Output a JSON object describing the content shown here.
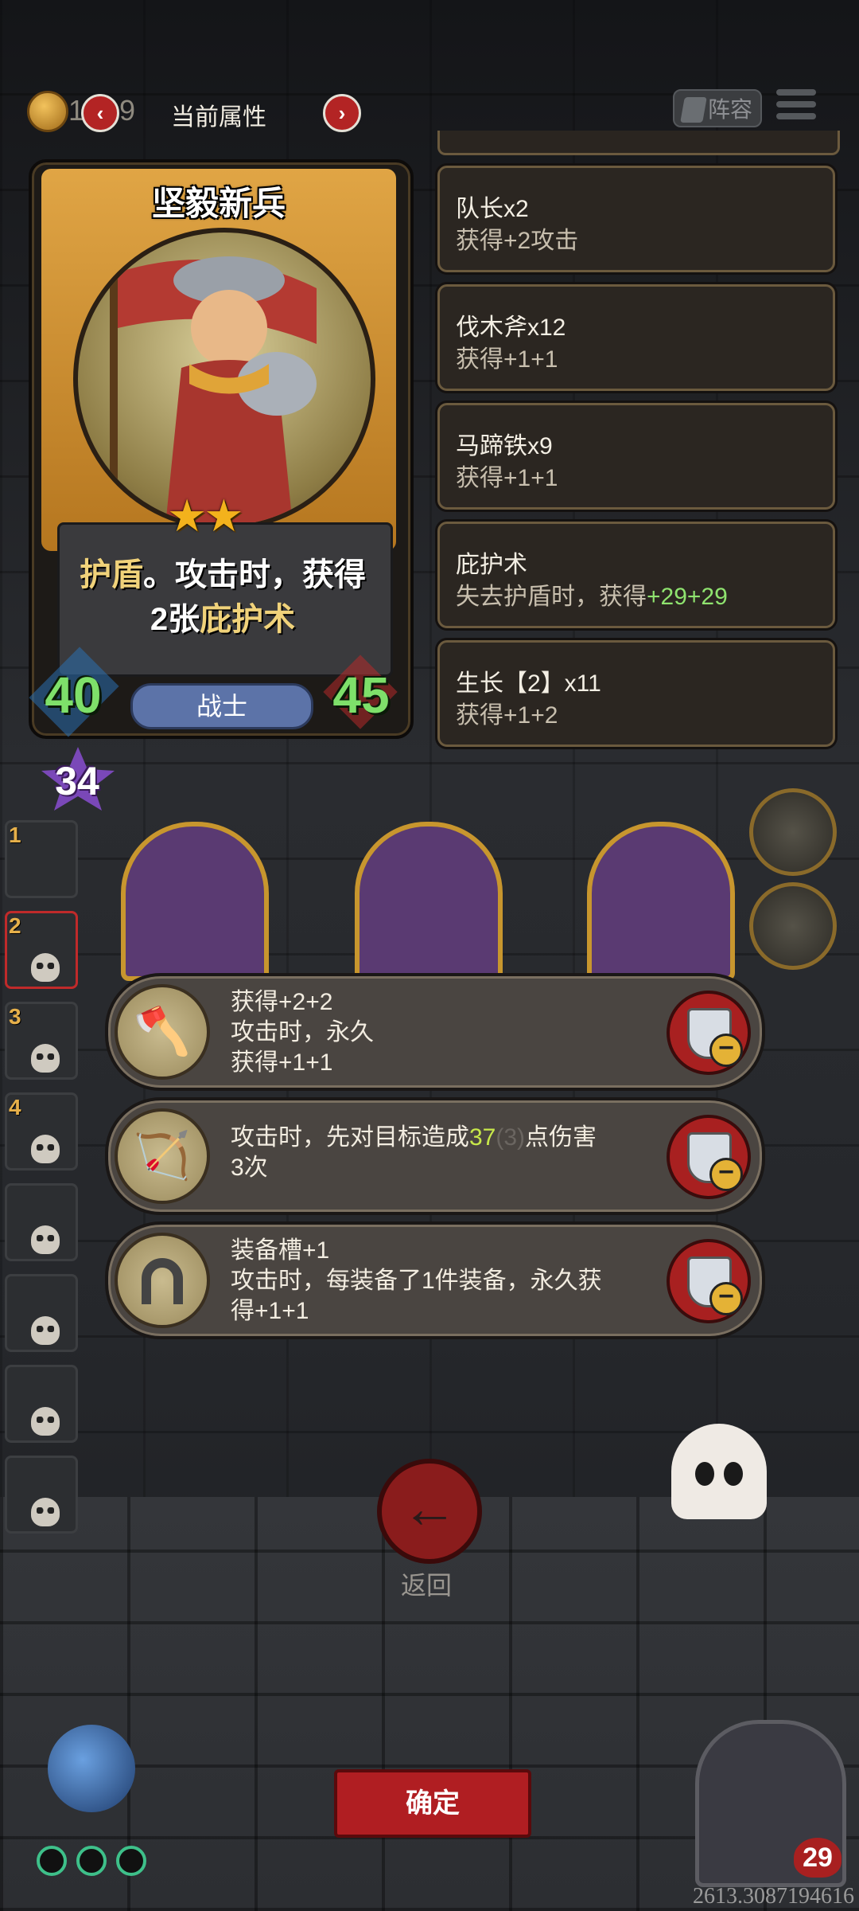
{
  "header": {
    "coin_value": "1",
    "coin_value_hidden": "9",
    "prev_icon": "chevron-left",
    "next_icon": "chevron-right",
    "title": "当前属性",
    "lineup_label": "阵容",
    "menu_icon": "hamburger-menu"
  },
  "hero": {
    "name": "坚毅新兵",
    "stars": "★★",
    "desc_part1": "护盾",
    "desc_part2": "。攻击时，获得",
    "desc_part3": "2张",
    "desc_part4": "庇护术",
    "attack": "40",
    "health": "45",
    "class": "战士",
    "level_badge": "34"
  },
  "attributes": [
    {
      "title": "队长x2",
      "sub_prefix": "获得",
      "sub_value": "+2攻击",
      "green": false
    },
    {
      "title": "伐木斧x12",
      "sub_prefix": "获得",
      "sub_value": "+1+1",
      "green": false
    },
    {
      "title": "马蹄铁x9",
      "sub_prefix": "获得",
      "sub_value": "+1+1",
      "green": false
    },
    {
      "title": "庇护术",
      "sub_prefix": "失去护盾时，获得",
      "sub_value": "+29+29",
      "green": true
    },
    {
      "title": "生长【2】x11",
      "sub_prefix": "获得",
      "sub_value": "+1+2",
      "green": false
    }
  ],
  "side_slots": [
    "1",
    "2",
    "3",
    "4",
    "",
    "",
    "",
    ""
  ],
  "equipment": [
    {
      "icon": "axe-icon",
      "line1": "获得+2+2",
      "line2": "攻击时，永久",
      "line3": "获得+1+1"
    },
    {
      "icon": "crossbow-icon",
      "line1_a": "攻击时，先对目标造成",
      "line1_b": "37",
      "line1_c": "(3)",
      "line1_d": "点伤害",
      "line2": "3次"
    },
    {
      "icon": "horseshoe-icon",
      "line1": "装备槽+1",
      "line2": "攻击时，每装备了1件装备，永久获",
      "line3": "得+1+1"
    }
  ],
  "footer": {
    "back_label": "返回",
    "confirm_label": "确定",
    "lives": "29",
    "coords": "2613.3087194616"
  },
  "colors": {
    "accent_red": "#b01e22",
    "highlight_green": "#8fe36f",
    "highlight_yellow": "#c8e84a",
    "gold": "#f0d27a"
  }
}
